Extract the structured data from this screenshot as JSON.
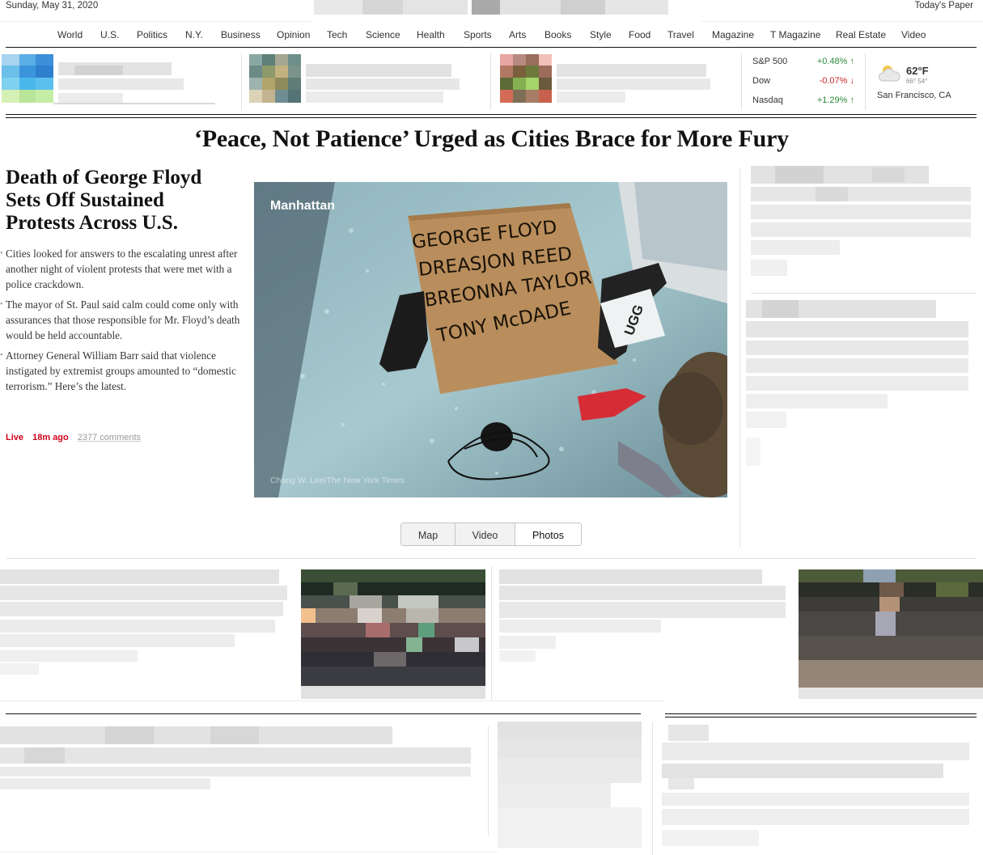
{
  "masthead": {
    "date": "Sunday, May 31, 2020",
    "todays_paper": "Today's Paper"
  },
  "nav": {
    "items": [
      "World",
      "U.S.",
      "Politics",
      "N.Y.",
      "Business",
      "Opinion",
      "Tech",
      "Science",
      "Health",
      "Sports",
      "Arts",
      "Books",
      "Style",
      "Food",
      "Travel",
      "Magazine",
      "T Magazine",
      "Real Estate",
      "Video"
    ]
  },
  "markets": [
    {
      "name": "S&P 500",
      "value": "+0.48%",
      "arrow": "↑",
      "direction": "up"
    },
    {
      "name": "Dow",
      "value": "-0.07%",
      "arrow": "↓",
      "direction": "down"
    },
    {
      "name": "Nasdaq",
      "value": "+1.29%",
      "arrow": "↑",
      "direction": "up"
    }
  ],
  "weather": {
    "icon": "partly-cloudy-icon",
    "temp": "62°F",
    "hilo": "66° 54°",
    "city": "San Francisco, CA"
  },
  "banner_headline": "‘Peace, Not Patience’ Urged as Cities Brace for More Fury",
  "lead": {
    "title": "Death of George Floyd Sets Off Sustained Protests Across U.S.",
    "summary": [
      "Cities looked for answers to the escalating unrest after another night of violent protests that were met with a police crackdown.",
      "The mayor of St. Paul said calm could come only with assurances that those responsible for Mr. Floyd’s death would be held accountable.",
      "Attorney General William Barr said that violence instigated by extremist groups amounted to “domestic terrorism.” Here’s the latest."
    ],
    "live": "Live",
    "time_ago": "18m ago",
    "comments": "2377 comments"
  },
  "photo": {
    "label": "Manhattan",
    "credit": "Chang W. Lee/The New York Times",
    "sign_lines": [
      "GEORGE FLOYD",
      "DREASJON REED",
      "BREONNA TAYLOR",
      "TONY McDADE"
    ],
    "box_text": "UGG"
  },
  "media_tabs": [
    "Map",
    "Video",
    "Photos"
  ],
  "colors": {
    "live_red": "#d0021b",
    "market_up": "#2d8a3b",
    "market_down": "#c4282a"
  }
}
